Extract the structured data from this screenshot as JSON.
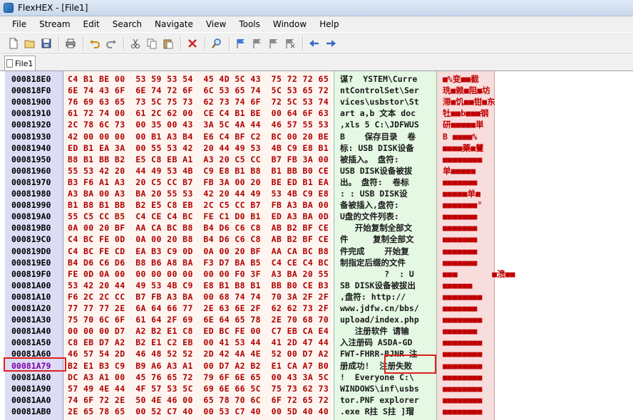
{
  "window": {
    "title": "FlexHEX - [File1]"
  },
  "menu": [
    "File",
    "Stream",
    "Edit",
    "Search",
    "Navigate",
    "View",
    "Tools",
    "Window",
    "Help"
  ],
  "toolbar": [
    "new-icon",
    "open-icon",
    "save-icon",
    "print-icon",
    "undo-icon",
    "redo-icon",
    "cut-icon",
    "copy-icon",
    "paste-icon",
    "delete-icon",
    "find-icon",
    "bookmark-icon",
    "bookmark-prev-icon",
    "bookmark-next-icon",
    "bookmark-clear-icon",
    "back-arrow-icon",
    "forward-arrow-icon"
  ],
  "tab": {
    "label": "File1"
  },
  "highlight": {
    "address": "00081A79",
    "text": "注册失败"
  },
  "rows": [
    {
      "addr": "000818E0",
      "hex": "C4 B1 BE 00  53 59 53 54  45 4D 5C 43  75 72 72 65",
      "text": "谋?  YSTEM\\Curre"
    },
    {
      "addr": "000818F0",
      "hex": "6E 74 43 6F  6E 74 72 6F  6C 53 65 74  5C 53 65 72",
      "text": "ntControlSet\\Ser"
    },
    {
      "addr": "00081900",
      "hex": "76 69 63 65  73 5C 75 73  62 73 74 6F  72 5C 53 74",
      "text": "vices\\usbstor\\St"
    },
    {
      "addr": "00081910",
      "hex": "61 72 74 00  61 2C 62 00  CE C4 B1 BE  00 64 6F 63",
      "text": "art a,b 文本 doc"
    },
    {
      "addr": "00081920",
      "hex": "2C 78 6C 73  00 35 00 43  3A 5C 4A 44  46 57 55 53",
      "text": ",xls 5 C:\\JDFWUS"
    },
    {
      "addr": "00081930",
      "hex": "42 00 00 00  00 B1 A3 B4  E6 C4 BF C2  BC 00 20 BE",
      "text": "B    保存目录  卷"
    },
    {
      "addr": "00081940",
      "hex": "ED B1 EA 3A  00 55 53 42  20 44 49 53  4B C9 E8 B1",
      "text": "标: USB DISK设备"
    },
    {
      "addr": "00081950",
      "hex": "B8 B1 BB B2  E5 C8 EB A1  A3 20 C5 CC  B7 FB 3A 00",
      "text": "被插入。 盘符:"
    },
    {
      "addr": "00081960",
      "hex": "55 53 42 20  44 49 53 4B  C9 E8 B1 B8  B1 BB B0 CE",
      "text": "USB DISK设备被拔"
    },
    {
      "addr": "00081970",
      "hex": "B3 F6 A1 A3  20 C5 CC B7  FB 3A 00 20  BE ED B1 EA",
      "text": "出。 盘符:  卷标"
    },
    {
      "addr": "00081980",
      "hex": "A3 BA 00 A3  BA 20 55 53  42 20 44 49  53 4B C9 E8",
      "text": ": : USB DISK设"
    },
    {
      "addr": "00081990",
      "hex": "B1 B8 B1 BB  B2 E5 C8 EB  2C C5 CC B7  FB A3 BA 00",
      "text": "备被插入,盘符:"
    },
    {
      "addr": "000819A0",
      "hex": "55 C5 CC B5  C4 CE C4 BC  FE C1 D0 B1  ED A3 BA 0D",
      "text": "U盘的文件列表:"
    },
    {
      "addr": "000819B0",
      "hex": "0A 00 20 BF  AA CA BC B8  B4 D6 C6 C8  AB B2 BF CE",
      "text": "   开始复制全部文"
    },
    {
      "addr": "000819C0",
      "hex": "C4 BC FE 0D  0A 00 20 B8  B4 D6 C6 C8  AB B2 BF CE",
      "text": "件     复制全部文"
    },
    {
      "addr": "000819D0",
      "hex": "C4 BC FE CD  EA B3 C9 0D  0A 00 20 BF  AA CA BC B8",
      "text": "件完成    开始复"
    },
    {
      "addr": "000819E0",
      "hex": "B4 D6 C6 D6  B8 B6 A8 BA  F3 D7 BA B5  C4 CE C4 BC",
      "text": "制指定后缀的文件"
    },
    {
      "addr": "000819F0",
      "hex": "FE 0D 0A 00  00 00 00 00  00 00 F0 3F  A3 BA 20 55",
      "text": "         ?  : U"
    },
    {
      "addr": "00081A00",
      "hex": "53 42 20 44  49 53 4B C9  E8 B1 B8 B1  BB B0 CE B3",
      "text": "SB DISK设备被拔出"
    },
    {
      "addr": "00081A10",
      "hex": "F6 2C 2C CC  B7 FB A3 BA  00 68 74 74  70 3A 2F 2F",
      "text": ",盘符: http://"
    },
    {
      "addr": "00081A20",
      "hex": "77 77 77 2E  6A 64 66 77  2E 63 6E 2F  62 62 73 2F",
      "text": "www.jdfw.cn/bbs/"
    },
    {
      "addr": "00081A30",
      "hex": "75 70 6C 6F  61 64 2F 69  6E 64 65 78  2E 70 68 70",
      "text": "upload/index.php"
    },
    {
      "addr": "00081A40",
      "hex": "00 00 00 D7  A2 B2 E1 C8  ED BC FE 00  C7 EB CA E4",
      "text": "   注册软件 请输"
    },
    {
      "addr": "00081A50",
      "hex": "C8 EB D7 A2  B2 E1 C2 EB  00 41 53 44  41 2D 47 44",
      "text": "入注册码 ASDA-GD"
    },
    {
      "addr": "00081A60",
      "hex": "46 57 54 2D  46 48 52 52  2D 42 4A 4E  52 00 D7 A2",
      "text": "FWT-FHRR-BJNR 注"
    },
    {
      "addr": "00081A79",
      "hex": "B2 E1 B3 C9  B9 A6 A3 A1  00 D7 A2 B2  E1 CA A7 B0",
      "text": "册成功!  注册失败"
    },
    {
      "addr": "00081A80",
      "hex": "DC A3 A1 00  45 76 65 72  79 6F 6E 65  00 43 3A 5C",
      "text": "!  Everyone C:\\"
    },
    {
      "addr": "00081A90",
      "hex": "57 49 4E 44  4F 57 53 5C  69 6E 66 5C  75 73 62 73",
      "text": "WINDOWS\\inf\\usbs"
    },
    {
      "addr": "00081AA0",
      "hex": "74 6F 72 2E  50 4E 46 00  65 78 70 6C  6F 72 65 72",
      "text": "tor.PNF explorer"
    },
    {
      "addr": "00081AB0",
      "hex": "2E 65 78 65  00 52 C7 40  00 53 C7 40  00 5D 40 40",
      "text": ".exe R拄 S拄 ]瑁"
    }
  ],
  "chars": [
    "■%变■■截",
    "珗■赖■阻■坊",
    "滞■饥■■钳■东",
    "牡■■b■■■钢",
    "研■■■■■単",
    "B ■■■■%",
    "■■■■藥■矍",
    "■■■■■■■■",
    "单■■■■■",
    "■■■■■■■",
    "■■■■■单■",
    "■■■■■■■°",
    "■■■■■■■",
    "■■■■■■■",
    "■■■■■■■",
    "■■■■■■■",
    "■■■■■■■",
    "■■■       ■溃■■",
    "■■■■■■",
    "■■■■■■■■",
    "■■■■■■■",
    "■■■■■■■■",
    "■■■■■■■",
    "■■■■■■■■",
    "■■■■■■■■",
    "■■■■■■■■",
    "■■■■■■■■",
    "■■■■■■■■",
    "■■■■■■■■",
    "■■■■■■■■"
  ]
}
